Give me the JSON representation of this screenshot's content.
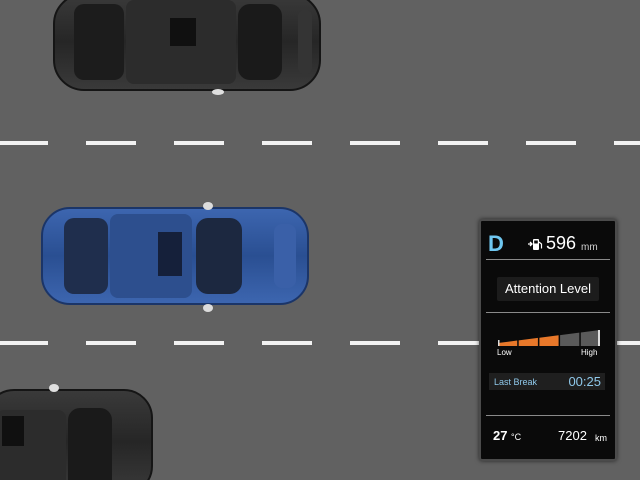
{
  "cluster": {
    "gear": "D",
    "fuel_icon": "fuel-pump-icon",
    "range_value": "596",
    "range_unit": "mm",
    "attention_title": "Attention Level",
    "attention_level": 0.6,
    "attention_low_label": "Low",
    "attention_high_label": "High",
    "last_break_label": "Last Break",
    "last_break_value": "00:25",
    "temperature_value": "27",
    "temperature_unit": "°C",
    "odometer_value": "7202",
    "odometer_unit": "km"
  },
  "colors": {
    "road": "#616161",
    "lane_marking": "#f2f2f2",
    "ego_car": "#2e4f8f",
    "other_car": "#2b2b2b",
    "accent_blue": "#6fc7f0",
    "meter_orange": "#e8782a",
    "meter_inactive": "#5a5a5a"
  }
}
